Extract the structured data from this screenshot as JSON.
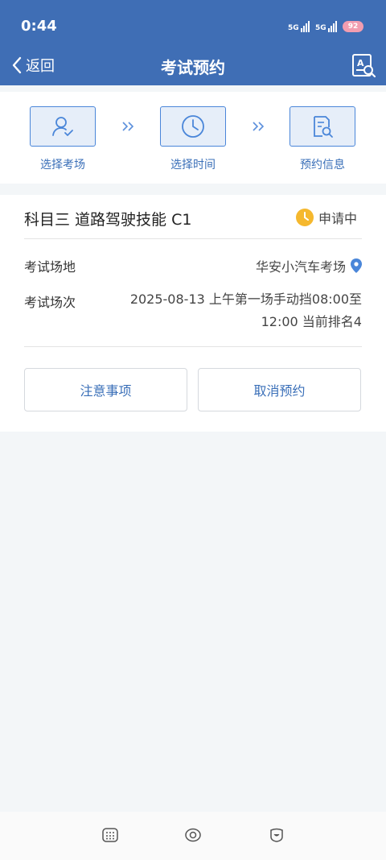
{
  "status_bar": {
    "time": "0:44",
    "sig1": "5G",
    "sig2": "5G",
    "battery": "92"
  },
  "header": {
    "back_label": "返回",
    "title": "考试预约"
  },
  "steps": [
    {
      "label": "选择考场",
      "icon": "user-check-icon"
    },
    {
      "label": "选择时间",
      "icon": "clock-icon"
    },
    {
      "label": "预约信息",
      "icon": "document-search-icon"
    }
  ],
  "card": {
    "subject": "科目三 道路驾驶技能 C1",
    "status": "申请中",
    "location_label": "考试场地",
    "location_value": "华安小汽车考场",
    "session_label": "考试场次",
    "session_value": "2025-08-13 上午第一场手动挡08:00至12:00 当前排名4",
    "notes_button": "注意事项",
    "cancel_button": "取消预约"
  },
  "colors": {
    "primary": "#3f6eb5",
    "accent": "#4a86d9",
    "status_yellow": "#f5b82e"
  }
}
